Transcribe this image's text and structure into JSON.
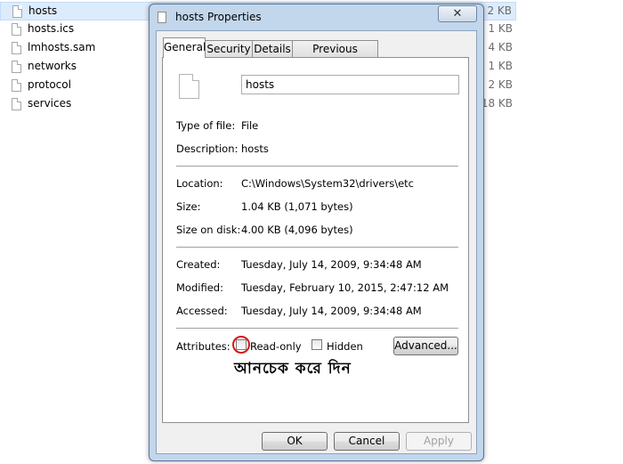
{
  "file_list": [
    {
      "name": "hosts",
      "size": "2 KB",
      "selected": true
    },
    {
      "name": "hosts.ics",
      "size": "1 KB"
    },
    {
      "name": "lmhosts.sam",
      "size": "4 KB"
    },
    {
      "name": "networks",
      "size": "1 KB"
    },
    {
      "name": "protocol",
      "size": "2 KB"
    },
    {
      "name": "services",
      "size": "18 KB"
    }
  ],
  "dialog": {
    "title": "hosts Properties",
    "close_glyph": "✕",
    "tabs": [
      "General",
      "Security",
      "Details",
      "Previous Versions"
    ],
    "active_tab": "General",
    "file_name": "hosts",
    "fields": {
      "type_label": "Type of file:",
      "type_value": "File",
      "description_label": "Description:",
      "description_value": "hosts",
      "location_label": "Location:",
      "location_value": "C:\\Windows\\System32\\drivers\\etc",
      "size_label": "Size:",
      "size_value": "1.04 KB (1,071 bytes)",
      "size_on_disk_label": "Size on disk:",
      "size_on_disk_value": "4.00 KB (4,096 bytes)",
      "created_label": "Created:",
      "created_value": "Tuesday, July 14, 2009, 9:34:48 AM",
      "modified_label": "Modified:",
      "modified_value": "Tuesday, February 10, 2015, 2:47:12 AM",
      "accessed_label": "Accessed:",
      "accessed_value": "Tuesday, July 14, 2009, 9:34:48 AM"
    },
    "attributes": {
      "label": "Attributes:",
      "readonly_label": "Read-only",
      "readonly_checked": false,
      "hidden_label": "Hidden",
      "hidden_checked": false,
      "advanced_label": "Advanced..."
    },
    "annotation_text": "আনচেক করে দিন",
    "highlight_color": "#d21a1a",
    "buttons": {
      "ok": "OK",
      "cancel": "Cancel",
      "apply": "Apply"
    }
  }
}
